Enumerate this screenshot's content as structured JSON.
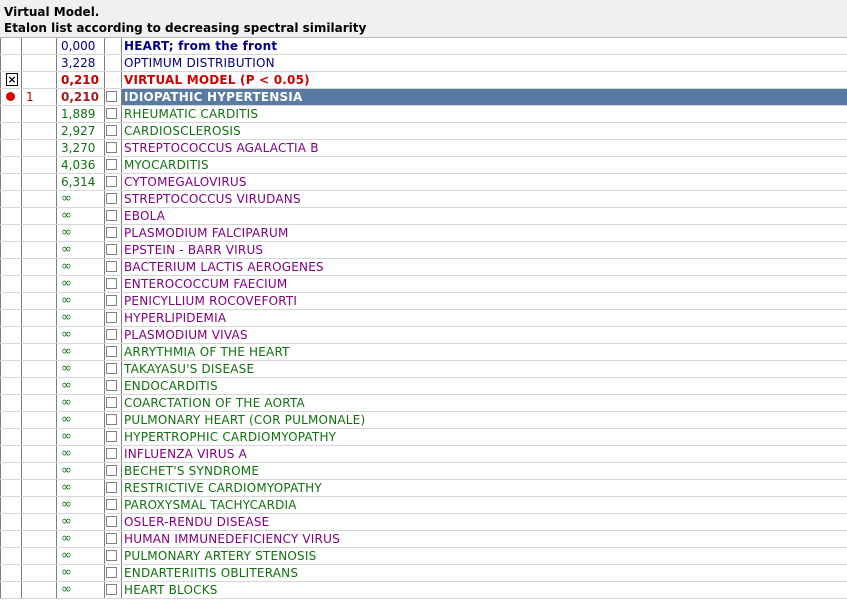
{
  "header": {
    "title": "Virtual Model.",
    "subtitle": "Etalon list according to decreasing spectral similarity"
  },
  "rows": [
    {
      "value": "0,000",
      "name": "HEART;  from the front",
      "style": "top-blue"
    },
    {
      "value": "3,228",
      "name": "OPTIMUM DISTRIBUTION",
      "style": "top-plain"
    },
    {
      "value": "0,210",
      "name": "VIRTUAL MODEL (P < 0.05)",
      "style": "virtual",
      "marker": "×"
    },
    {
      "value": "0,210",
      "name": "IDIOPATHIC  HYPERTENSIA",
      "style": "selected",
      "rank": "1"
    },
    {
      "value": "1,889",
      "name": "RHEUMATIC  CARDITIS",
      "color": "green"
    },
    {
      "value": "2,927",
      "name": "CARDIOSCLEROSIS",
      "color": "green"
    },
    {
      "value": "3,270",
      "name": "STREPTOCOCCUS  AGALACTIA  B",
      "color": "purple"
    },
    {
      "value": "4,036",
      "name": "MYOCARDITIS",
      "color": "green"
    },
    {
      "value": "6,314",
      "name": "CYTOMEGALOVIRUS",
      "color": "purple"
    },
    {
      "value": "∞",
      "name": "STREPTOCOCCUS VIRUDANS",
      "color": "purple"
    },
    {
      "value": "∞",
      "name": "EBOLA",
      "color": "purple"
    },
    {
      "value": "∞",
      "name": "PLASMODIUM FALCIPARUM",
      "color": "purple"
    },
    {
      "value": "∞",
      "name": "EPSTEIN - BARR VIRUS",
      "color": "purple"
    },
    {
      "value": "∞",
      "name": "BACTERIUM  LACTIS  AEROGENES",
      "color": "purple"
    },
    {
      "value": "∞",
      "name": "ENTEROCOCCUM  FAECIUM",
      "color": "purple"
    },
    {
      "value": "∞",
      "name": "PENICYLLIUM  ROCOVEFORTI",
      "color": "purple"
    },
    {
      "value": "∞",
      "name": "HYPERLIPIDEMIA",
      "color": "purple"
    },
    {
      "value": "∞",
      "name": "PLASMODIUM VIVAS",
      "color": "purple"
    },
    {
      "value": "∞",
      "name": "ARRYTHMIA  OF  THE HEART",
      "color": "green"
    },
    {
      "value": "∞",
      "name": "TAKAYASU'S DISEASE",
      "color": "green"
    },
    {
      "value": "∞",
      "name": "ENDOCARDITIS",
      "color": "green"
    },
    {
      "value": "∞",
      "name": "COARCTATION OF THE AORTA",
      "color": "green"
    },
    {
      "value": "∞",
      "name": "PULMONARY HEART (COR PULMONALE)",
      "color": "green"
    },
    {
      "value": "∞",
      "name": "HYPERTROPHIC  CARDIOMYOPATHY",
      "color": "green"
    },
    {
      "value": "∞",
      "name": "INFLUENZA VIRUS A",
      "color": "purple"
    },
    {
      "value": "∞",
      "name": "BECHET'S  SYNDROME",
      "color": "green"
    },
    {
      "value": "∞",
      "name": "RESTRICTIVE CARDIOMYOPATHY",
      "color": "green"
    },
    {
      "value": "∞",
      "name": "PAROXYSMAL  TACHYCARDIA",
      "color": "green"
    },
    {
      "value": "∞",
      "name": "OSLER-RENDU DISEASE",
      "color": "purple"
    },
    {
      "value": "∞",
      "name": "HUMAN  IMMUNEDEFICIENCY  VIRUS",
      "color": "purple"
    },
    {
      "value": "∞",
      "name": "PULMONARY  ARTERY  STENOSIS",
      "color": "green"
    },
    {
      "value": "∞",
      "name": "ENDARTERIITIS  OBLITERANS",
      "color": "green"
    },
    {
      "value": "∞",
      "name": "HEART  BLOCKS",
      "color": "green"
    }
  ],
  "colors": {
    "green": "#107010",
    "purple": "#800080",
    "blue": "#000080",
    "red": "#d00000",
    "selection": "#5a7aa6"
  }
}
